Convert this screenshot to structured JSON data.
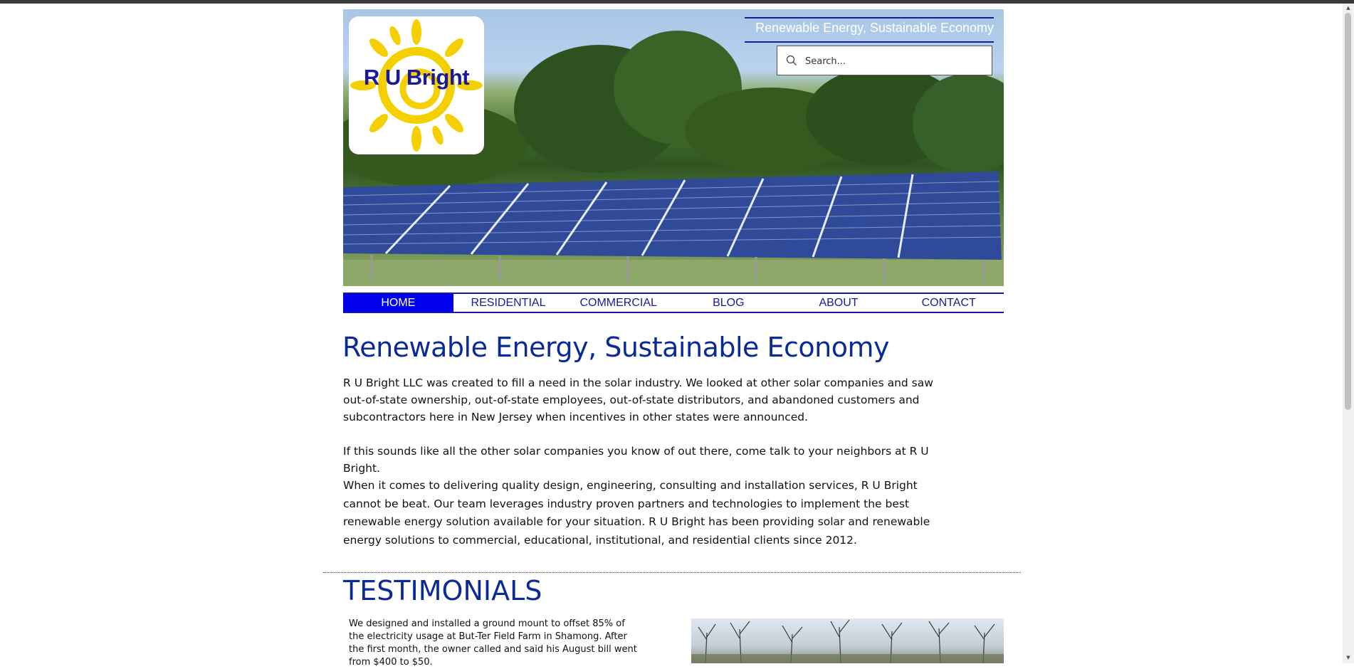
{
  "header": {
    "logo_text": "R U Bright",
    "tagline": "Renewable Energy, Sustainable Economy",
    "search": {
      "placeholder": "Search..."
    }
  },
  "nav": {
    "items": [
      {
        "label": "HOME",
        "active": true
      },
      {
        "label": "RESIDENTIAL",
        "active": false
      },
      {
        "label": "COMMERCIAL",
        "active": false
      },
      {
        "label": "BLOG",
        "active": false
      },
      {
        "label": "ABOUT",
        "active": false
      },
      {
        "label": "CONTACT",
        "active": false
      }
    ]
  },
  "main": {
    "headline": "Renewable Energy, Sustainable Economy",
    "paragraphs": [
      "R U Bright LLC was created to fill a need in the solar industry.  We looked at other solar companies and saw out-of-state ownership, out-of-state employees, out-of-state distributors, and abandoned customers and subcontractors here in New Jersey when incentives in other states were announced.",
      "If this sounds like all the other solar companies you know of out there, come talk to your neighbors at R U Bright.",
      "When it comes to delivering quality design, engineering, consulting and installation services, R U Bright cannot be beat.  Our team leverages industry proven partners and technologies to implement the best renewable energy solution available for your situation.  R U Bright has been providing solar and renewable energy solutions to commercial, educational, institutional, and residential clients since 2012."
    ]
  },
  "testimonials": {
    "title": "TESTIMONIALS",
    "first_text": "We designed and installed a ground mount to offset 85% of the electricity usage at But-Ter Field Farm in Shamong.  After the first month, the owner called and said his August bill went from $400 to $50."
  },
  "colors": {
    "brand_blue": "#1a1a9a",
    "nav_active": "#0000ee",
    "headline": "#0b2a9a",
    "sun_yellow": "#f5d000"
  },
  "icons": {
    "search": "magnifier-icon",
    "logo": "sun-icon"
  }
}
